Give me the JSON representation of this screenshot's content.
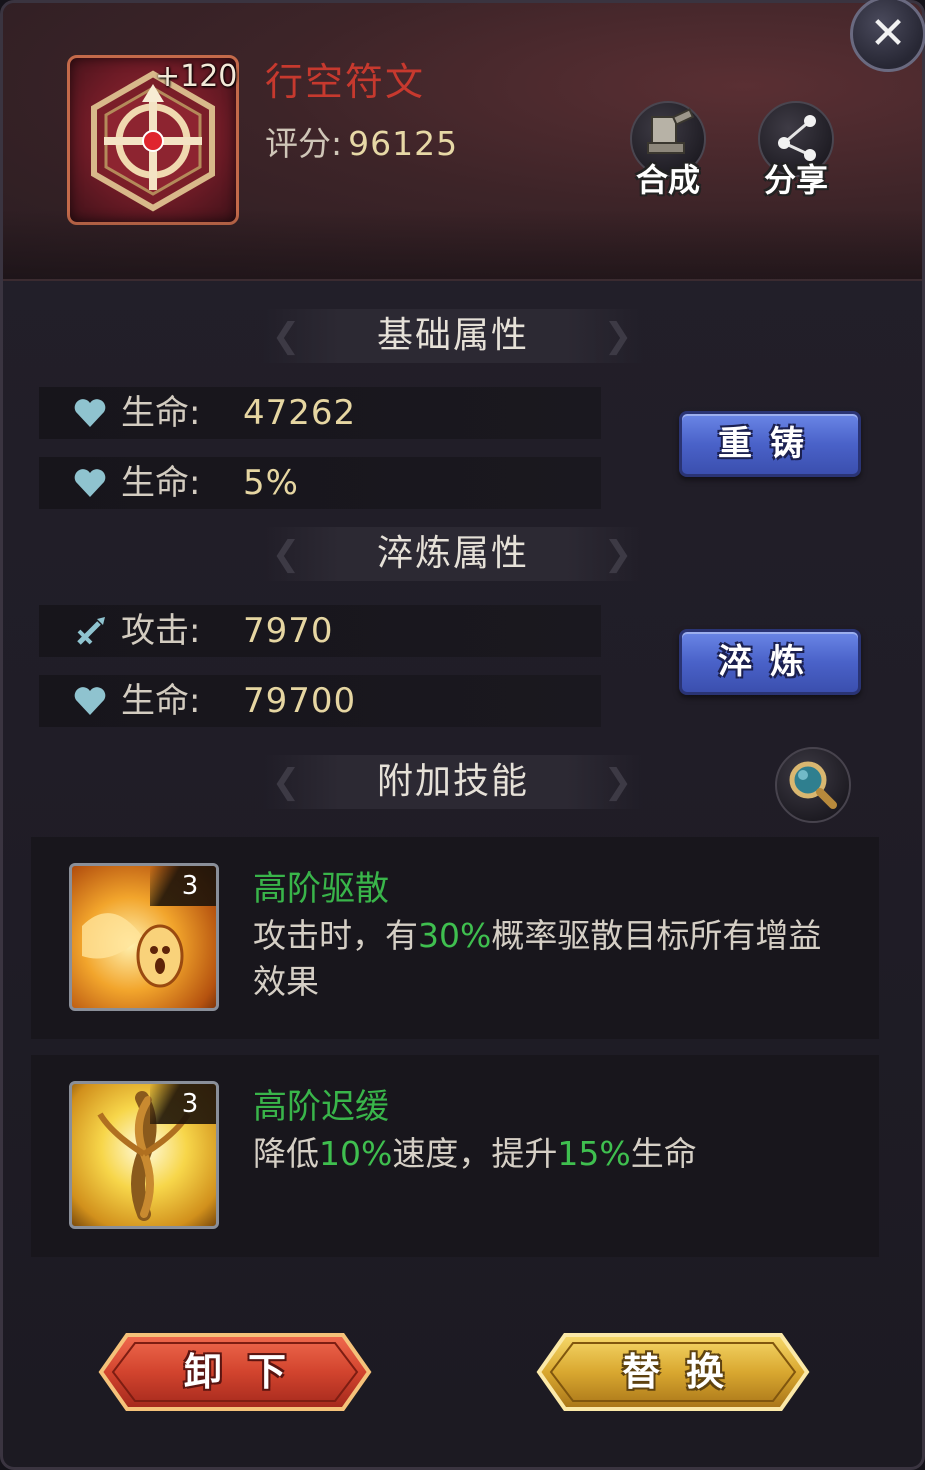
{
  "item": {
    "name": "行空符文",
    "level_badge": "+120",
    "score_label": "评分:",
    "score_value": "96125",
    "icon": "hexagon-rune-icon"
  },
  "header_buttons": {
    "compose_label": "合成",
    "share_label": "分享",
    "compose_icon": "anvil-icon",
    "share_icon": "share-nodes-icon"
  },
  "close_icon": "close-icon",
  "sections": {
    "base_title": "基础属性",
    "refine_title": "淬炼属性",
    "skills_title": "附加技能"
  },
  "base_stats": [
    {
      "icon": "heart-icon",
      "label": "生命:",
      "value": "47262"
    },
    {
      "icon": "heart-icon",
      "label": "生命:",
      "value": "5%"
    }
  ],
  "refine_stats": [
    {
      "icon": "sword-icon",
      "label": "攻击:",
      "value": "7970"
    },
    {
      "icon": "heart-icon",
      "label": "生命:",
      "value": "79700"
    }
  ],
  "buttons": {
    "recast": "重铸",
    "refine": "淬炼",
    "unequip": "卸下",
    "replace": "替换"
  },
  "skills": [
    {
      "name": "高阶驱散",
      "level": "3",
      "desc_parts": [
        "攻击时，有",
        "30%",
        "概率驱散目标所有增益效果"
      ]
    },
    {
      "name": "高阶迟缓",
      "level": "3",
      "desc_parts": [
        "降低",
        "10%",
        "速度，提升",
        "15%",
        "生命"
      ]
    }
  ],
  "colors": {
    "item_name": "#c7392e",
    "highlight_green": "#3fbf4f",
    "stat_value": "#e6d6a2",
    "blue_button": "#4a62c9",
    "red_button": "#c53a2a",
    "gold_button": "#d6a72e"
  }
}
